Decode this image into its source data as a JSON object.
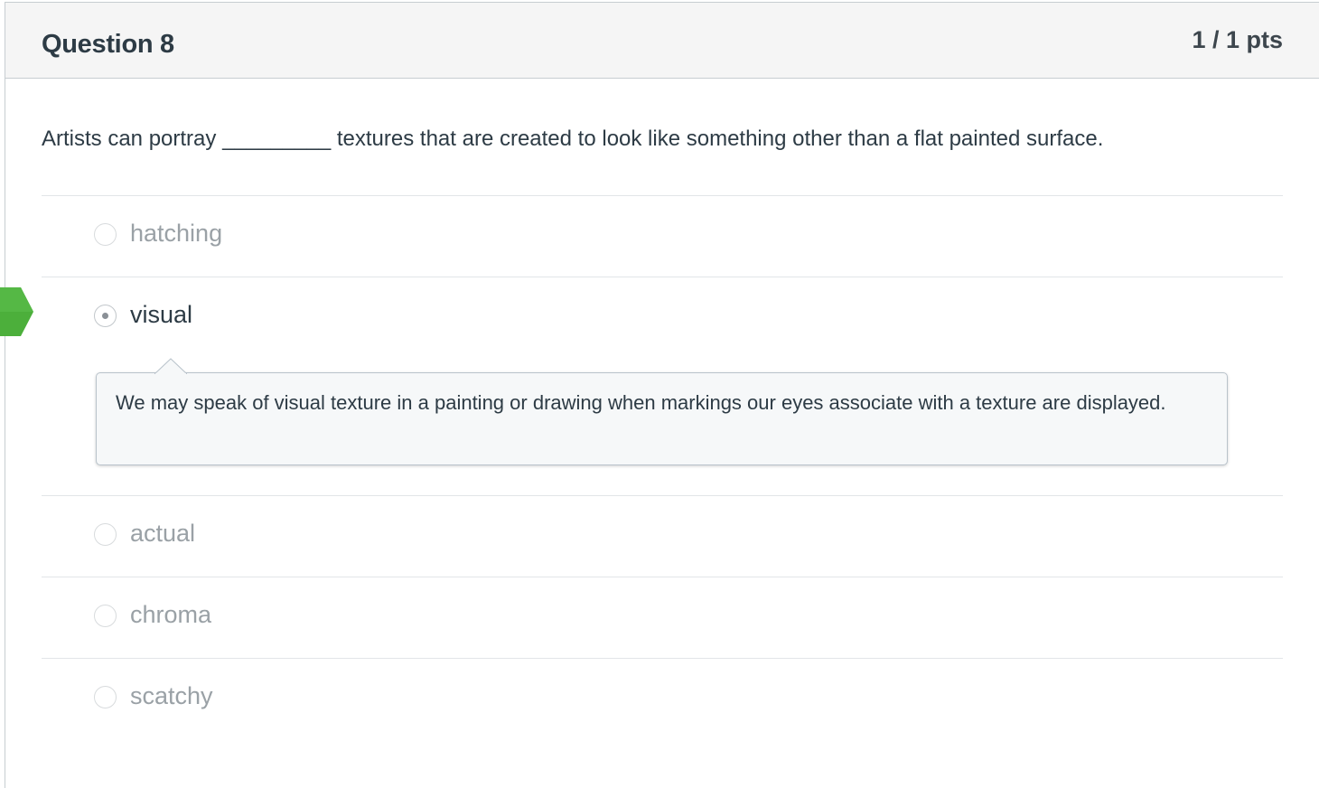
{
  "question": {
    "title": "Question 8",
    "points": "1 / 1 pts",
    "text": "Artists can portray _________ textures that are created to look like something other than a flat painted surface."
  },
  "answers": [
    {
      "label": "hatching",
      "selected": false
    },
    {
      "label": "visual",
      "selected": true,
      "correct": true
    },
    {
      "label": "actual",
      "selected": false
    },
    {
      "label": "chroma",
      "selected": false
    },
    {
      "label": "scatchy",
      "selected": false
    }
  ],
  "comment": {
    "text": "We may speak of visual texture in a painting or drawing when markings our eyes associate with a texture are displayed."
  },
  "colors": {
    "correct_marker": "#4caf3b",
    "header_bg": "#f5f5f5",
    "comment_bg": "#f6f8f9"
  },
  "icons": {
    "correct_answer_marker": "correct-arrow-icon",
    "radio": "radio-button-icon"
  }
}
